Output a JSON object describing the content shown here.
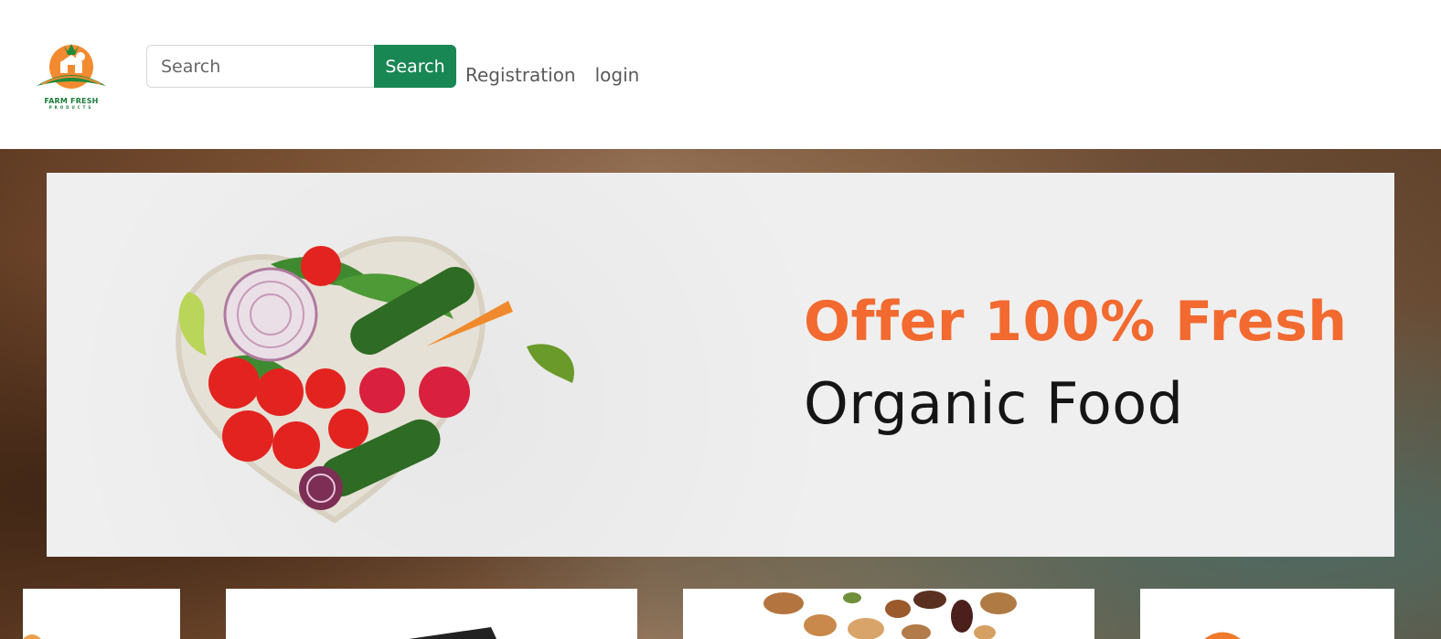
{
  "header": {
    "logo": {
      "brand": "FARM FRESH",
      "tagline": "PRODUCTS",
      "icon": "farm-logo-icon"
    },
    "search": {
      "placeholder": "Search",
      "button_label": "Search"
    },
    "nav": [
      {
        "label": "Registration"
      },
      {
        "label": "login"
      }
    ]
  },
  "banner": {
    "headline": "Offer 100% Fresh",
    "subline": "Organic Food",
    "image": "heart-vegetables-image",
    "colors": {
      "headline": "#f26a30",
      "subline": "#151515",
      "button": "#198754"
    }
  },
  "cards": [
    {
      "image": "product-image-1"
    },
    {
      "image": "product-image-2"
    },
    {
      "image": "nuts-product-image"
    },
    {
      "image": "product-image-4"
    }
  ]
}
